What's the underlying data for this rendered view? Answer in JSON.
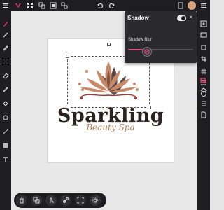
{
  "toolbar": {
    "icons": [
      "menu-icon",
      "logo-icon",
      "grid-icon",
      "layers-stack-icon",
      "group-icon",
      "ungroup-icon",
      "undo-icon",
      "redo-icon",
      "pages-icon",
      "more-icon"
    ]
  },
  "canvas": {
    "brand_name": "Sparkling",
    "tagline": "Beauty Spa",
    "logo_colors": {
      "petal_main": "#c98a6b",
      "petal_dark": "#4a2a26",
      "accent": "#9b3b3b"
    }
  },
  "shadow_panel": {
    "title": "Shadow",
    "enabled": true,
    "close_label": "×",
    "blur_label": "Shadow Blur",
    "blur_value_fraction": 0.32,
    "accent": "#e04b7c"
  },
  "left_tools": [
    "brush-icon",
    "pen-icon",
    "pencil-icon",
    "shape-icon",
    "eraser-icon",
    "smudge-icon",
    "fill-icon",
    "stamp-icon",
    "line-icon",
    "gradient-icon",
    "text-icon"
  ],
  "right_tools": [
    "add-icon",
    "image-icon",
    "frame-icon",
    "crop-icon",
    "grid-icon",
    "align-icon",
    "color-icon",
    "shadow-icon",
    "layers-icon",
    "adjust-icon",
    "page-icon"
  ],
  "bottom_actions": [
    "delete-icon",
    "duplicate-icon",
    "touch-icon",
    "link-icon",
    "fit-icon",
    "settings-icon"
  ]
}
